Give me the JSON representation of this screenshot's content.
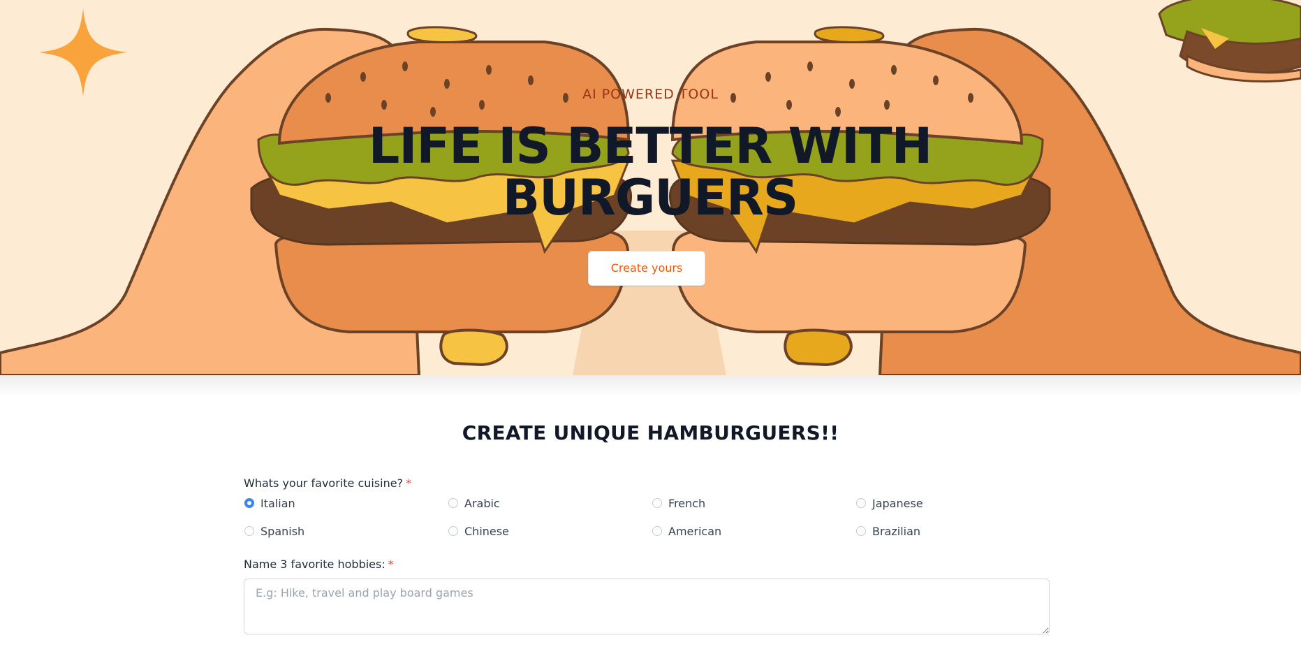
{
  "hero": {
    "eyebrow": "AI POWERED TOOL",
    "title": "LIFE IS BETTER WITH BURGUERS",
    "cta_label": "Create yours",
    "background_color": "#FEEBD3",
    "accent_color": "#EA580C"
  },
  "form": {
    "title": "CREATE UNIQUE HAMBURGUERS!!",
    "cuisine": {
      "label": "Whats your favorite cuisine?",
      "required_mark": "*",
      "selected": "Italian",
      "options": [
        {
          "label": "Italian"
        },
        {
          "label": "Arabic"
        },
        {
          "label": "French"
        },
        {
          "label": "Japanese"
        },
        {
          "label": "Spanish"
        },
        {
          "label": "Chinese"
        },
        {
          "label": "American"
        },
        {
          "label": "Brazilian"
        }
      ]
    },
    "hobbies": {
      "label": "Name 3 favorite hobbies:",
      "required_mark": "*",
      "value": "",
      "placeholder": "E.g: Hike, travel and play board games"
    }
  },
  "icons": {
    "sparkle": "sparkle-star-icon",
    "radio_checked_color": "#3B82F6",
    "required_color": "#EF4444"
  }
}
